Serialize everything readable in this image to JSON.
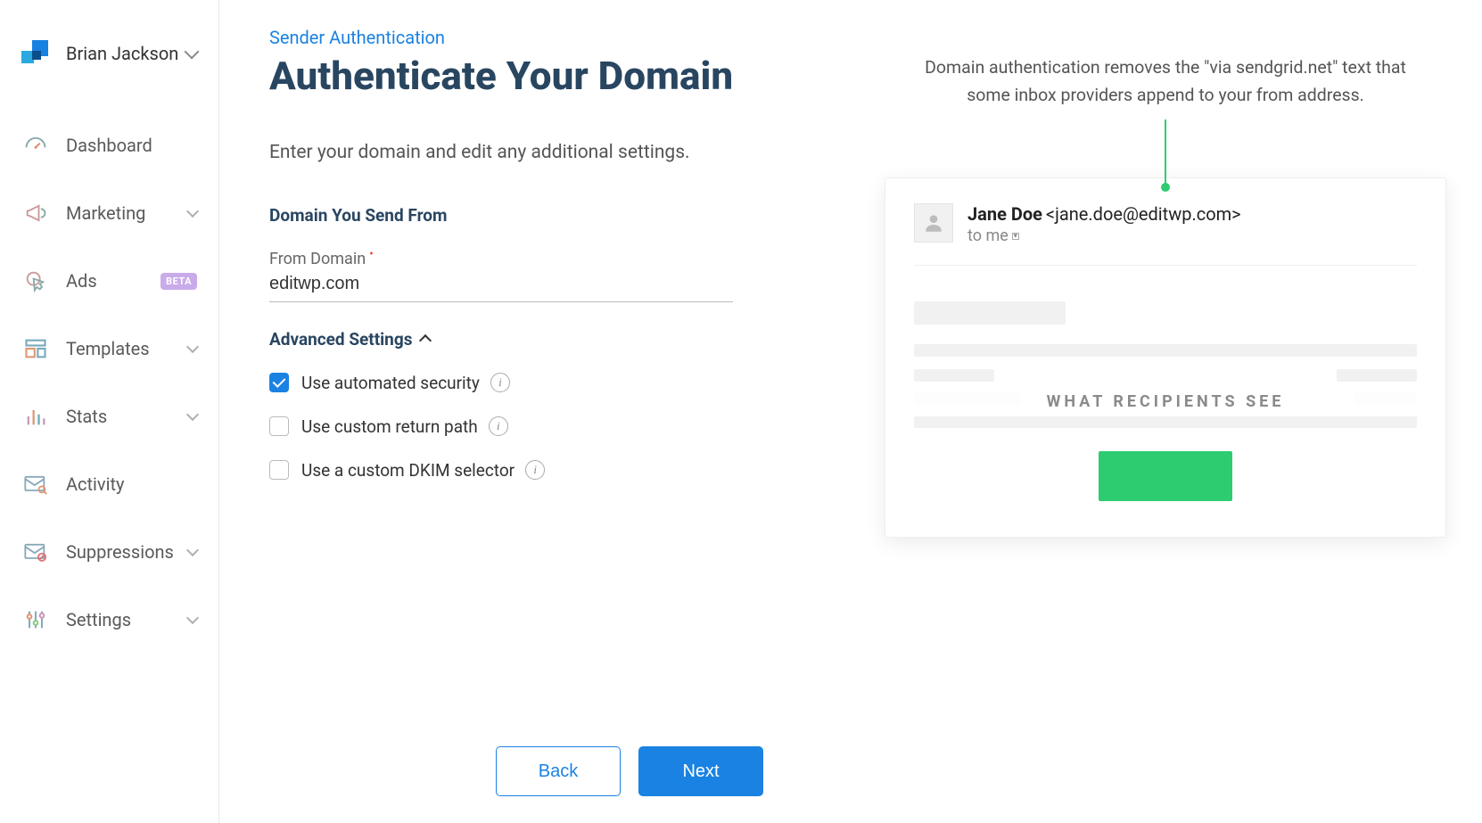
{
  "user": {
    "name": "Brian Jackson"
  },
  "sidebar": {
    "items": [
      {
        "label": "Dashboard",
        "expandable": false,
        "badge": null
      },
      {
        "label": "Marketing",
        "expandable": true,
        "badge": null
      },
      {
        "label": "Ads",
        "expandable": false,
        "badge": "BETA"
      },
      {
        "label": "Templates",
        "expandable": true,
        "badge": null
      },
      {
        "label": "Stats",
        "expandable": true,
        "badge": null
      },
      {
        "label": "Activity",
        "expandable": false,
        "badge": null
      },
      {
        "label": "Suppressions",
        "expandable": true,
        "badge": null
      },
      {
        "label": "Settings",
        "expandable": true,
        "badge": null
      }
    ]
  },
  "page": {
    "breadcrumb": "Sender Authentication",
    "title": "Authenticate Your Domain",
    "subtext": "Enter your domain and edit any additional settings.",
    "section1": "Domain You Send From",
    "fromDomainLabel": "From Domain",
    "fromDomainValue": "editwp.com",
    "advancedLabel": "Advanced Settings",
    "options": [
      {
        "label": "Use automated security",
        "checked": true
      },
      {
        "label": "Use custom return path",
        "checked": false
      },
      {
        "label": "Use a custom DKIM selector",
        "checked": false
      }
    ],
    "buttons": {
      "back": "Back",
      "next": "Next"
    }
  },
  "preview": {
    "description": "Domain authentication removes the \"via sendgrid.net\" text that some inbox providers append to your from address.",
    "fromName": "Jane Doe",
    "fromEmail": "<jane.doe@editwp.com>",
    "toText": "to me",
    "overlay": "WHAT RECIPIENTS SEE"
  }
}
